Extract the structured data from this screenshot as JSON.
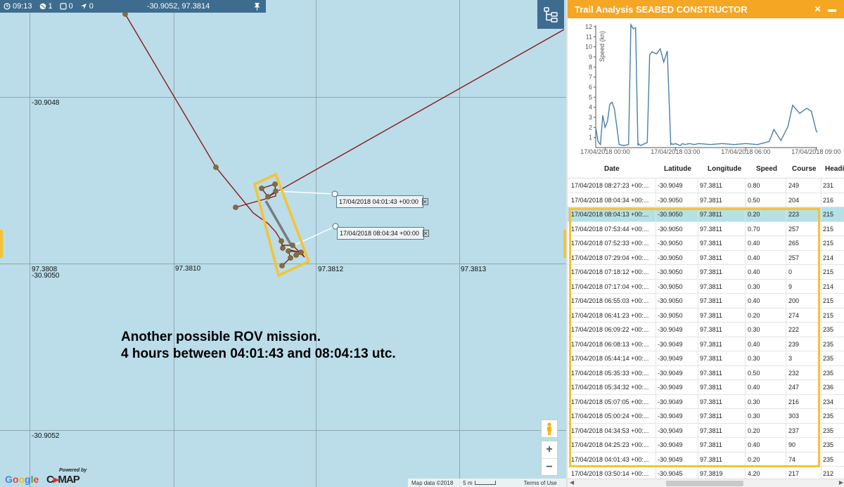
{
  "topbar": {
    "time": "09:13",
    "globe_count": "1",
    "square_count": "0",
    "nav_count": "0",
    "position": "-30.9052, 97.3814"
  },
  "map": {
    "grid_labels": {
      "lat_top": "-30.9048",
      "lon_left": "97.3808",
      "lat_mid": "-30.9050",
      "lon_2": "97.3810",
      "lon_3": "97.3812",
      "lon_4": "97.3813",
      "lat_bottom": "-30.9052"
    },
    "popup_1": "17/04/2018 04:01:43 +00:00",
    "popup_2": "17/04/2018 08:04:34 +00:00",
    "close_glyph": "✕",
    "annotation_line1": "Another possible ROV mission.",
    "annotation_line2": "4 hours between 04:01:43 and 08:04:13 utc.",
    "zoom_in": "+",
    "zoom_out": "−",
    "google": "Google",
    "cmap_powered": "Powered by",
    "cmap_brand_left": "C",
    "cmap_brand_mid": "▸",
    "cmap_brand_right": "MAP",
    "attribution": "Map data ©2018",
    "scale": "5 m",
    "terms": "Terms of Use",
    "colors": {
      "sea": "#badde9",
      "track": "#8b1a1a",
      "point": "#8b6b3a",
      "highlight": "#f5c332"
    }
  },
  "panel": {
    "title": "Trail Analysis SEABED CONSTRUCTOR",
    "controls": "✕",
    "columns": [
      "Date",
      "Latitude",
      "Longitude",
      "Speed",
      "Course",
      "Heading"
    ],
    "rows": [
      [
        "17/04/2018 08:27:23 +00:...",
        "-30.9049",
        "97.3811",
        "0.80",
        "249",
        "231"
      ],
      [
        "17/04/2018 08:04:34 +00:...",
        "-30.9050",
        "97.3811",
        "0.50",
        "204",
        "216"
      ],
      [
        "17/04/2018 08:04:13 +00:...",
        "-30.9050",
        "97.3811",
        "0.20",
        "223",
        "215"
      ],
      [
        "17/04/2018 07:53:44 +00:...",
        "-30.9050",
        "97.3811",
        "0.70",
        "257",
        "215"
      ],
      [
        "17/04/2018 07:52:33 +00:...",
        "-30.9050",
        "97.3811",
        "0.40",
        "265",
        "215"
      ],
      [
        "17/04/2018 07:29:04 +00:...",
        "-30.9050",
        "97.3811",
        "0.40",
        "257",
        "214"
      ],
      [
        "17/04/2018 07:18:12 +00:...",
        "-30.9050",
        "97.3811",
        "0.40",
        "0",
        "215"
      ],
      [
        "17/04/2018 07:17:04 +00:...",
        "-30.9050",
        "97.3811",
        "0.30",
        "9",
        "214"
      ],
      [
        "17/04/2018 06:55:03 +00:...",
        "-30.9050",
        "97.3811",
        "0.40",
        "200",
        "215"
      ],
      [
        "17/04/2018 06:41:23 +00:...",
        "-30.9050",
        "97.3811",
        "0.20",
        "274",
        "215"
      ],
      [
        "17/04/2018 06:09:22 +00:...",
        "-30.9049",
        "97.3811",
        "0.30",
        "222",
        "235"
      ],
      [
        "17/04/2018 06:08:13 +00:...",
        "-30.9049",
        "97.3811",
        "0.40",
        "239",
        "235"
      ],
      [
        "17/04/2018 05:44:14 +00:...",
        "-30.9049",
        "97.3811",
        "0.30",
        "3",
        "235"
      ],
      [
        "17/04/2018 05:35:33 +00:...",
        "-30.9049",
        "97.3811",
        "0.50",
        "232",
        "235"
      ],
      [
        "17/04/2018 05:34:32 +00:...",
        "-30.9049",
        "97.3811",
        "0.40",
        "247",
        "236"
      ],
      [
        "17/04/2018 05:07:05 +00:...",
        "-30.9049",
        "97.3811",
        "0.30",
        "216",
        "234"
      ],
      [
        "17/04/2018 05:00:24 +00:...",
        "-30.9049",
        "97.3811",
        "0.30",
        "303",
        "235"
      ],
      [
        "17/04/2018 04:34:53 +00:...",
        "-30.9049",
        "97.3811",
        "0.20",
        "237",
        "235"
      ],
      [
        "17/04/2018 04:25:23 +00:...",
        "-30.9049",
        "97.3811",
        "0.40",
        "90",
        "235"
      ],
      [
        "17/04/2018 04:01:43 +00:...",
        "-30.9049",
        "97.3811",
        "0.20",
        "74",
        "235"
      ],
      [
        "17/04/2018 03:50:14 +00:...",
        "-30.9045",
        "97.3819",
        "4.20",
        "217",
        "212"
      ]
    ],
    "selected_row": 2
  },
  "chart_data": {
    "type": "line",
    "ylabel": "Speed (kn)",
    "ylim": [
      0,
      12
    ],
    "yticks": [
      "1",
      "2",
      "3",
      "4",
      "5",
      "6",
      "7",
      "8",
      "9",
      "10",
      "11",
      "12"
    ],
    "xtick_labels": [
      "17/04/2018 00:00",
      "17/04/2018 03:00",
      "17/04/2018 06:00",
      "17/04/2018 09:00"
    ],
    "x_hours": [
      -0.4,
      -0.3,
      -0.2,
      -0.1,
      0.0,
      0.1,
      0.2,
      0.3,
      0.4,
      0.6,
      0.8,
      1.0,
      1.1,
      1.2,
      1.3,
      1.4,
      1.42,
      1.5,
      1.6,
      1.7,
      1.8,
      1.9,
      2.0,
      2.1,
      2.2,
      2.35,
      2.5,
      2.65,
      2.8,
      2.85,
      2.9,
      3.0,
      3.1,
      3.2,
      3.3,
      3.4,
      3.6,
      3.8,
      4.0,
      4.5,
      5.0,
      5.5,
      6.0,
      6.5,
      7.0,
      7.2,
      7.5,
      7.8,
      8.0,
      8.3,
      8.6,
      8.8,
      9.0,
      9.05
    ],
    "values": [
      2.0,
      0.6,
      0.3,
      3.2,
      2.0,
      2.6,
      4.3,
      4.5,
      3.8,
      0.3,
      0.2,
      0.3,
      12.2,
      11.8,
      11.9,
      0.2,
      0.4,
      0.2,
      0.3,
      0.4,
      0.5,
      9.2,
      9.5,
      9.4,
      9.3,
      9.8,
      8.5,
      9.6,
      0.3,
      0.4,
      0.3,
      0.4,
      0.3,
      0.2,
      0.4,
      0.3,
      0.4,
      0.3,
      0.4,
      0.3,
      0.4,
      0.3,
      0.4,
      0.3,
      0.6,
      1.8,
      0.7,
      2.1,
      4.2,
      3.4,
      3.9,
      3.6,
      1.7,
      1.5
    ]
  }
}
